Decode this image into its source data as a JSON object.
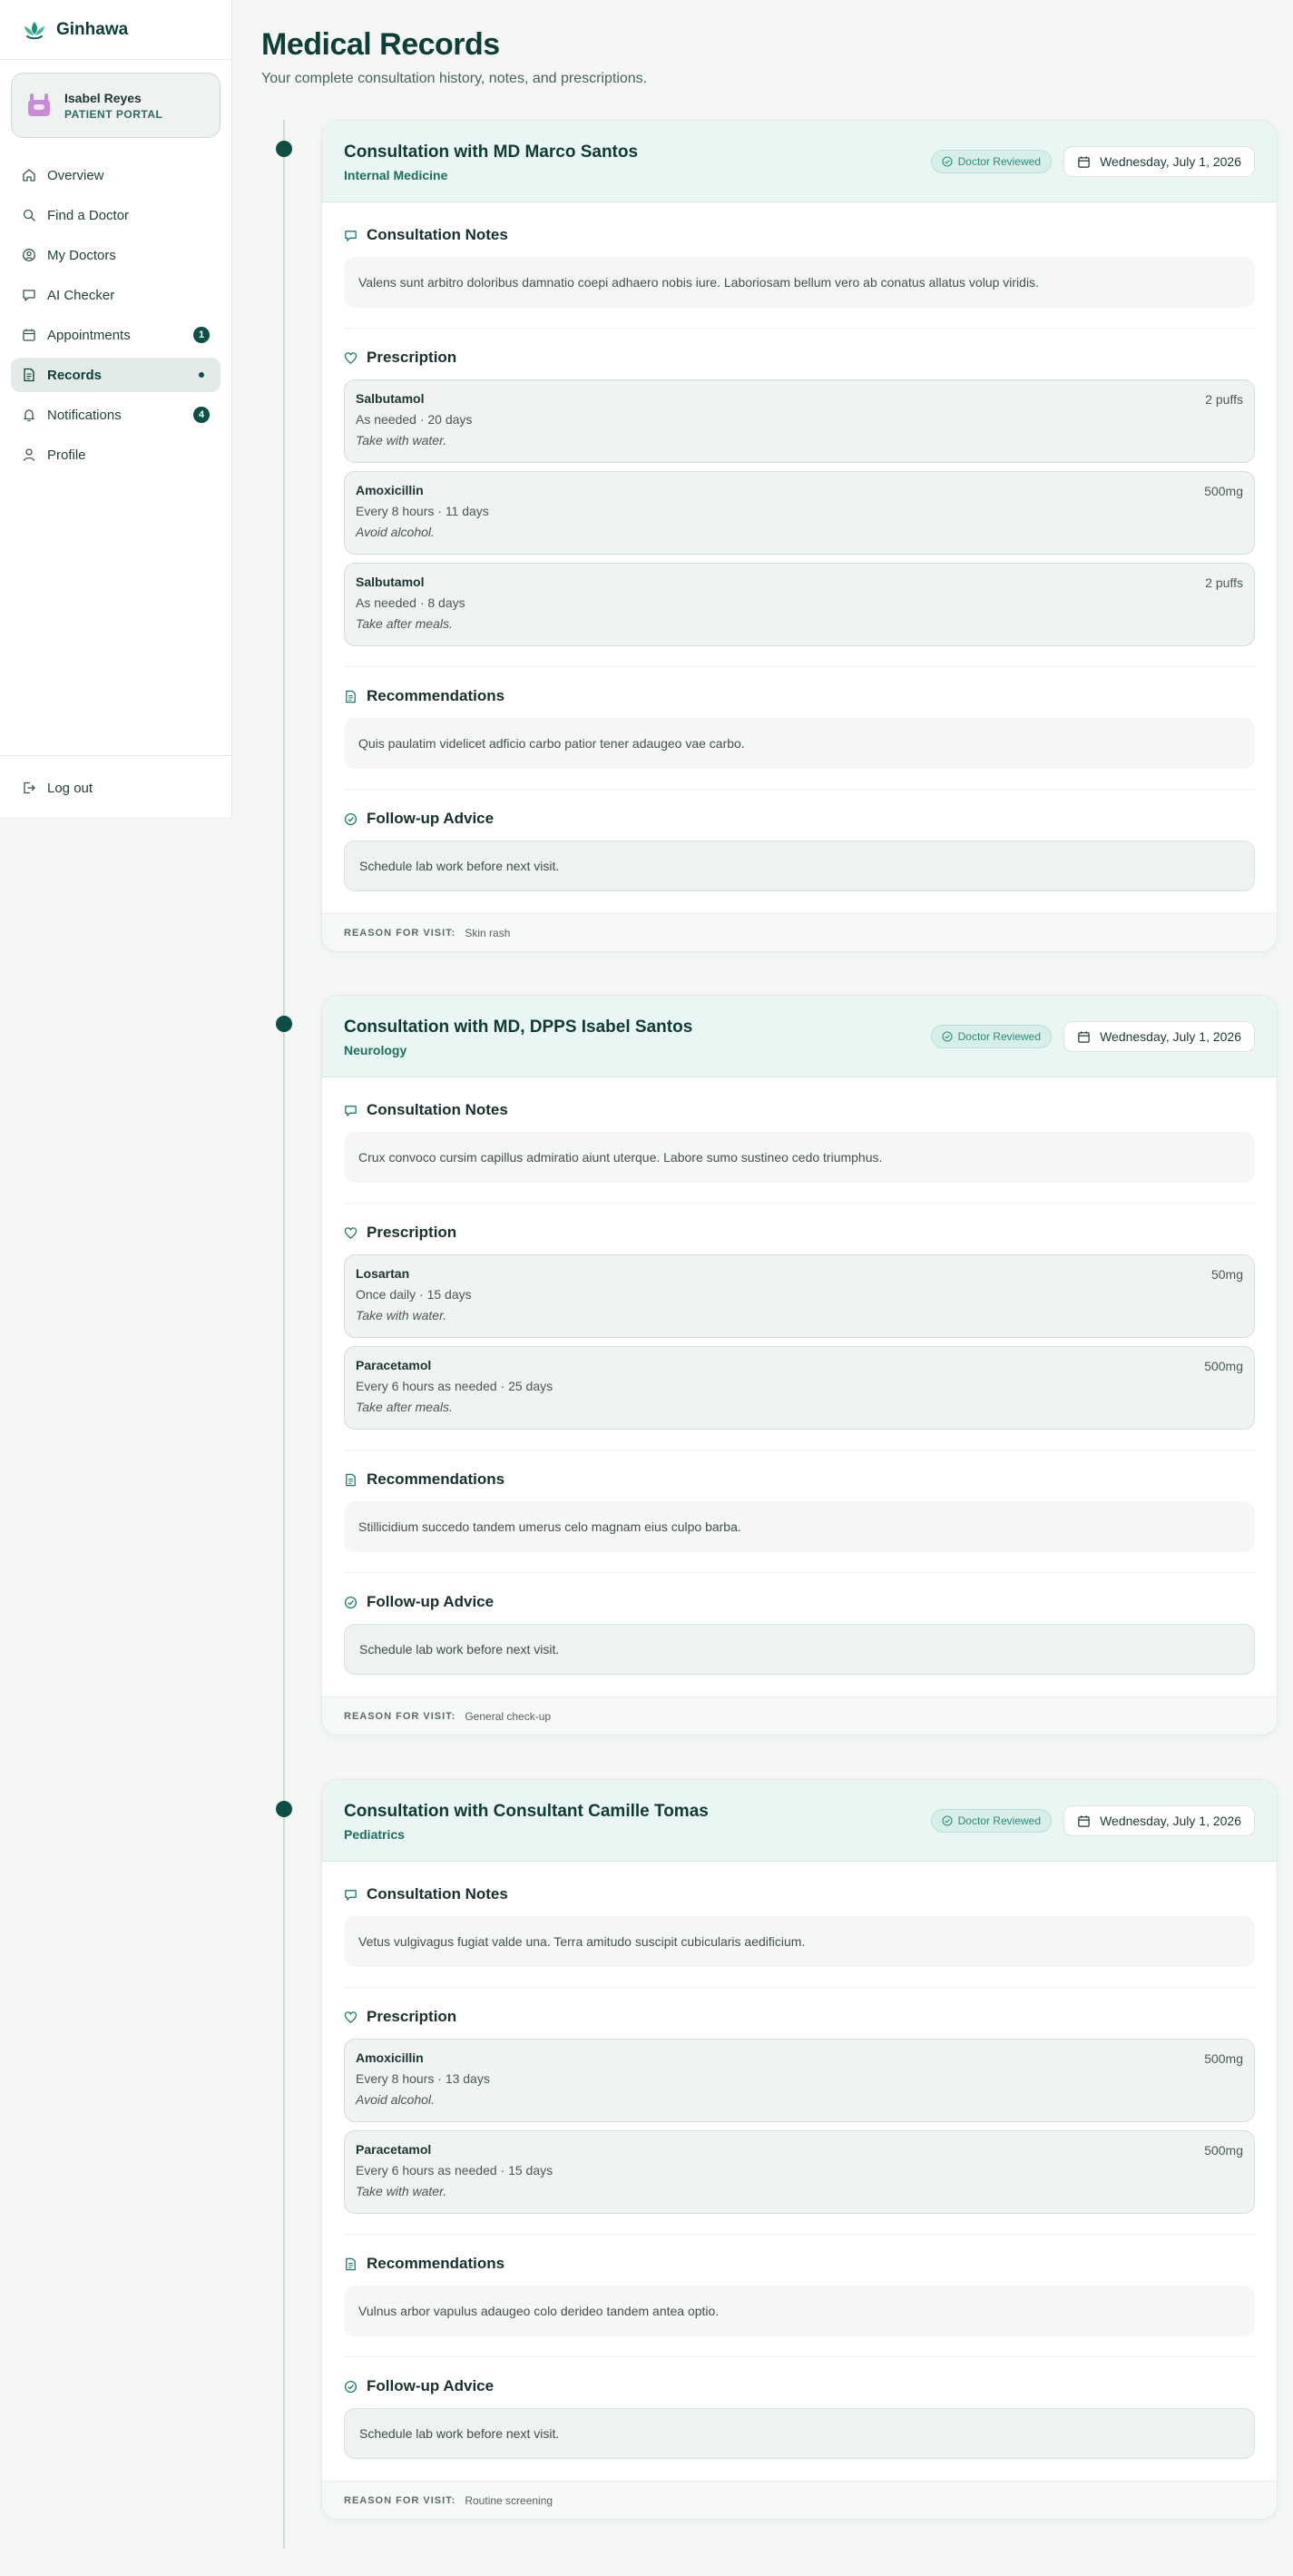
{
  "brand": {
    "name": "Ginhawa"
  },
  "user": {
    "name": "Isabel Reyes",
    "role": "PATIENT PORTAL"
  },
  "nav": [
    {
      "label": "Overview",
      "icon": "home-icon"
    },
    {
      "label": "Find a Doctor",
      "icon": "search-icon"
    },
    {
      "label": "My Doctors",
      "icon": "user-circle-icon"
    },
    {
      "label": "AI Checker",
      "icon": "chat-icon"
    },
    {
      "label": "Appointments",
      "icon": "calendar-icon",
      "badge": "1"
    },
    {
      "label": "Records",
      "icon": "document-icon",
      "active": true
    },
    {
      "label": "Notifications",
      "icon": "bell-icon",
      "badge": "4"
    },
    {
      "label": "Profile",
      "icon": "person-icon"
    }
  ],
  "logout": {
    "label": "Log out"
  },
  "page": {
    "title": "Medical Records",
    "subtitle": "Your complete consultation history, notes, and prescriptions."
  },
  "labels": {
    "notes": "Consultation Notes",
    "prescription": "Prescription",
    "recommendations": "Recommendations",
    "followup": "Follow-up Advice",
    "reason": "REASON FOR VISIT:",
    "reviewed": "Doctor Reviewed"
  },
  "records": [
    {
      "title": "Consultation with MD Marco Santos",
      "specialty": "Internal Medicine",
      "date": "Wednesday, July 1, 2026",
      "notes": "Valens sunt arbitro doloribus damnatio coepi adhaero nobis iure. Laboriosam bellum vero ab conatus allatus volup viridis.",
      "prescriptions": [
        {
          "name": "Salbutamol",
          "dose": "2 puffs",
          "freq": "As needed · 20 days",
          "note": "Take with water."
        },
        {
          "name": "Amoxicillin",
          "dose": "500mg",
          "freq": "Every 8 hours · 11 days",
          "note": "Avoid alcohol."
        },
        {
          "name": "Salbutamol",
          "dose": "2 puffs",
          "freq": "As needed · 8 days",
          "note": "Take after meals."
        }
      ],
      "recommendations": "Quis paulatim videlicet adficio carbo patior tener adaugeo vae carbo.",
      "followup": "Schedule lab work before next visit.",
      "reason": "Skin rash"
    },
    {
      "title": "Consultation with MD, DPPS Isabel Santos",
      "specialty": "Neurology",
      "date": "Wednesday, July 1, 2026",
      "notes": "Crux convoco cursim capillus admiratio aiunt uterque. Labore sumo sustineo cedo triumphus.",
      "prescriptions": [
        {
          "name": "Losartan",
          "dose": "50mg",
          "freq": "Once daily · 15 days",
          "note": "Take with water."
        },
        {
          "name": "Paracetamol",
          "dose": "500mg",
          "freq": "Every 6 hours as needed · 25 days",
          "note": "Take after meals."
        }
      ],
      "recommendations": "Stillicidium succedo tandem umerus celo magnam eius culpo barba.",
      "followup": "Schedule lab work before next visit.",
      "reason": "General check-up"
    },
    {
      "title": "Consultation with Consultant Camille Tomas",
      "specialty": "Pediatrics",
      "date": "Wednesday, July 1, 2026",
      "notes": "Vetus vulgivagus fugiat valde una. Terra amitudo suscipit cubicularis aedificium.",
      "prescriptions": [
        {
          "name": "Amoxicillin",
          "dose": "500mg",
          "freq": "Every 8 hours · 13 days",
          "note": "Avoid alcohol."
        },
        {
          "name": "Paracetamol",
          "dose": "500mg",
          "freq": "Every 6 hours as needed · 15 days",
          "note": "Take with water."
        }
      ],
      "recommendations": "Vulnus arbor vapulus adaugeo colo derideo tandem antea optio.",
      "followup": "Schedule lab work before next visit.",
      "reason": "Routine screening"
    }
  ]
}
